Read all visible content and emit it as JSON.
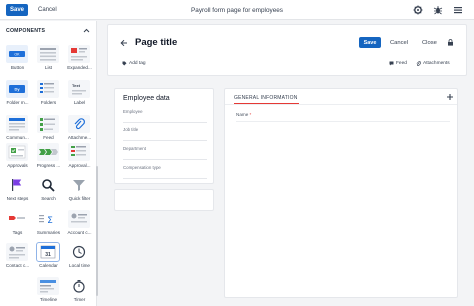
{
  "topbar": {
    "save_label": "Save",
    "cancel_label": "Cancel",
    "title": "Payroll form page for employees",
    "icons": [
      "settings-gear-icon",
      "debug-icon",
      "menu-list-icon"
    ]
  },
  "sidebar": {
    "heading": "COMPONENTS",
    "items": [
      {
        "label": "Button",
        "icon": "button-icon"
      },
      {
        "label": "List",
        "icon": "list-icon"
      },
      {
        "label": "Expanded...",
        "icon": "expanded-list-icon"
      },
      {
        "label": "Folder m...",
        "icon": "folder-manager-icon"
      },
      {
        "label": "Folders",
        "icon": "folders-icon"
      },
      {
        "label": "Label",
        "icon": "label-icon"
      },
      {
        "label": "Commun...",
        "icon": "communication-icon"
      },
      {
        "label": "Feed",
        "icon": "feed-icon"
      },
      {
        "label": "Attachme...",
        "icon": "attachments-icon"
      },
      {
        "label": "Approvals",
        "icon": "approvals-icon"
      },
      {
        "label": "Progress ...",
        "icon": "progress-bar-icon"
      },
      {
        "label": "Approval...",
        "icon": "approval-list-icon"
      },
      {
        "label": "Next steps",
        "icon": "next-steps-flag-icon"
      },
      {
        "label": "Search",
        "icon": "search-icon"
      },
      {
        "label": "Quick filter",
        "icon": "quick-filter-icon"
      },
      {
        "label": "Tags",
        "icon": "tags-icon"
      },
      {
        "label": "Summaries",
        "icon": "summaries-icon"
      },
      {
        "label": "Account c...",
        "icon": "account-compact-icon"
      },
      {
        "label": "Contact c...",
        "icon": "contact-compact-icon"
      },
      {
        "label": "Calendar",
        "icon": "calendar-icon"
      },
      {
        "label": "Local time",
        "icon": "clock-icon"
      },
      {
        "label": "Timeline",
        "icon": "timeline-icon"
      },
      {
        "label": "Timer",
        "icon": "timer-icon"
      }
    ]
  },
  "page": {
    "title": "Page title",
    "save_label": "Save",
    "cancel_label": "Cancel",
    "close_label": "Close",
    "add_tag_label": "Add tag",
    "feed_label": "Feed",
    "attachments_label": "Attachments"
  },
  "employee": {
    "title": "Employee data",
    "fields": [
      "Employee",
      "Job title",
      "Department",
      "Compensation type"
    ]
  },
  "general": {
    "tab_label": "GENERAL INFORMATION",
    "name_label": "Name",
    "required_mark": "*"
  },
  "colors": {
    "primary": "#1565c0",
    "accent_red": "#e53935",
    "background": "#f3f4f6"
  }
}
